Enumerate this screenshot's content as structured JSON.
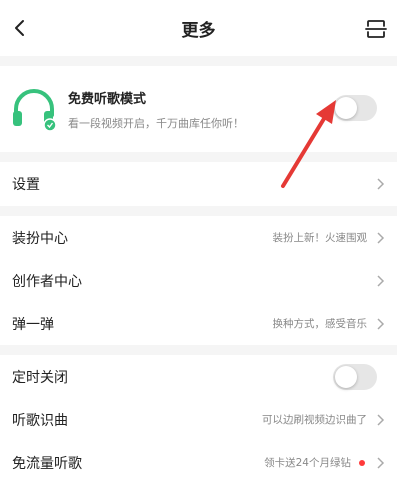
{
  "header": {
    "title": "更多"
  },
  "free_mode": {
    "title": "免费听歌模式",
    "subtitle": "看一段视频开启，千万曲库任你听！",
    "toggle_on": false
  },
  "settings": {
    "label": "设置"
  },
  "group1": [
    {
      "label": "装扮中心",
      "hint": "装扮上新！火速围观"
    },
    {
      "label": "创作者中心",
      "hint": ""
    },
    {
      "label": "弹一弹",
      "hint": "换种方式，感受音乐"
    }
  ],
  "group2": {
    "timer": {
      "label": "定时关闭",
      "toggle_on": false
    },
    "recognize": {
      "label": "听歌识曲",
      "hint": "可以边刷视频边识曲了"
    },
    "data_free": {
      "label": "免流量听歌",
      "hint": "领卡送24个月绿钻",
      "has_dot": true
    }
  },
  "colors": {
    "accent_green": "#37c27d",
    "arrow_red": "#e53935",
    "dot_red": "#ff3a3a"
  }
}
